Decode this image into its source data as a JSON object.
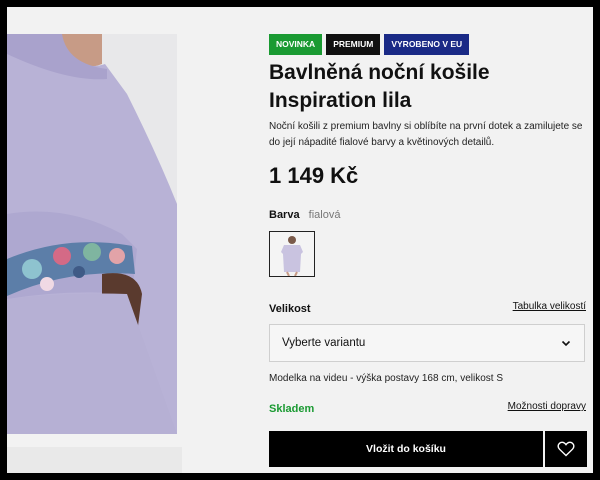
{
  "badges": [
    {
      "label": "NOVINKA",
      "color": "#1a9a32"
    },
    {
      "label": "PREMIUM",
      "color": "#111111"
    },
    {
      "label": "VYROBENO V EU",
      "color": "#1a2a86"
    }
  ],
  "product": {
    "title_line1": "Bavlněná noční košile",
    "title_line2": "Inspiration lila",
    "description": "Noční košili z premium bavlny si oblíbíte na první dotek a zamilujete se do její nápadité fialové barvy a květinových detailů.",
    "price": "1 149 Kč"
  },
  "color": {
    "label": "Barva",
    "value": "fialová",
    "swatch_color": "#c9c3e0"
  },
  "size": {
    "label": "Velikost",
    "table_link": "Tabulka velikostí",
    "select_value": "Vyberte variantu"
  },
  "model_note": "Modelka na videu - výška postavy 168 cm, velikost S",
  "stock": {
    "label": "Skladem",
    "color": "#1a9a32"
  },
  "shipping_link": "Možnosti dopravy",
  "cart": {
    "label": "Vložit do košíku"
  },
  "icons": {
    "wishlist": "heart-icon",
    "select": "chevron-down-icon"
  }
}
